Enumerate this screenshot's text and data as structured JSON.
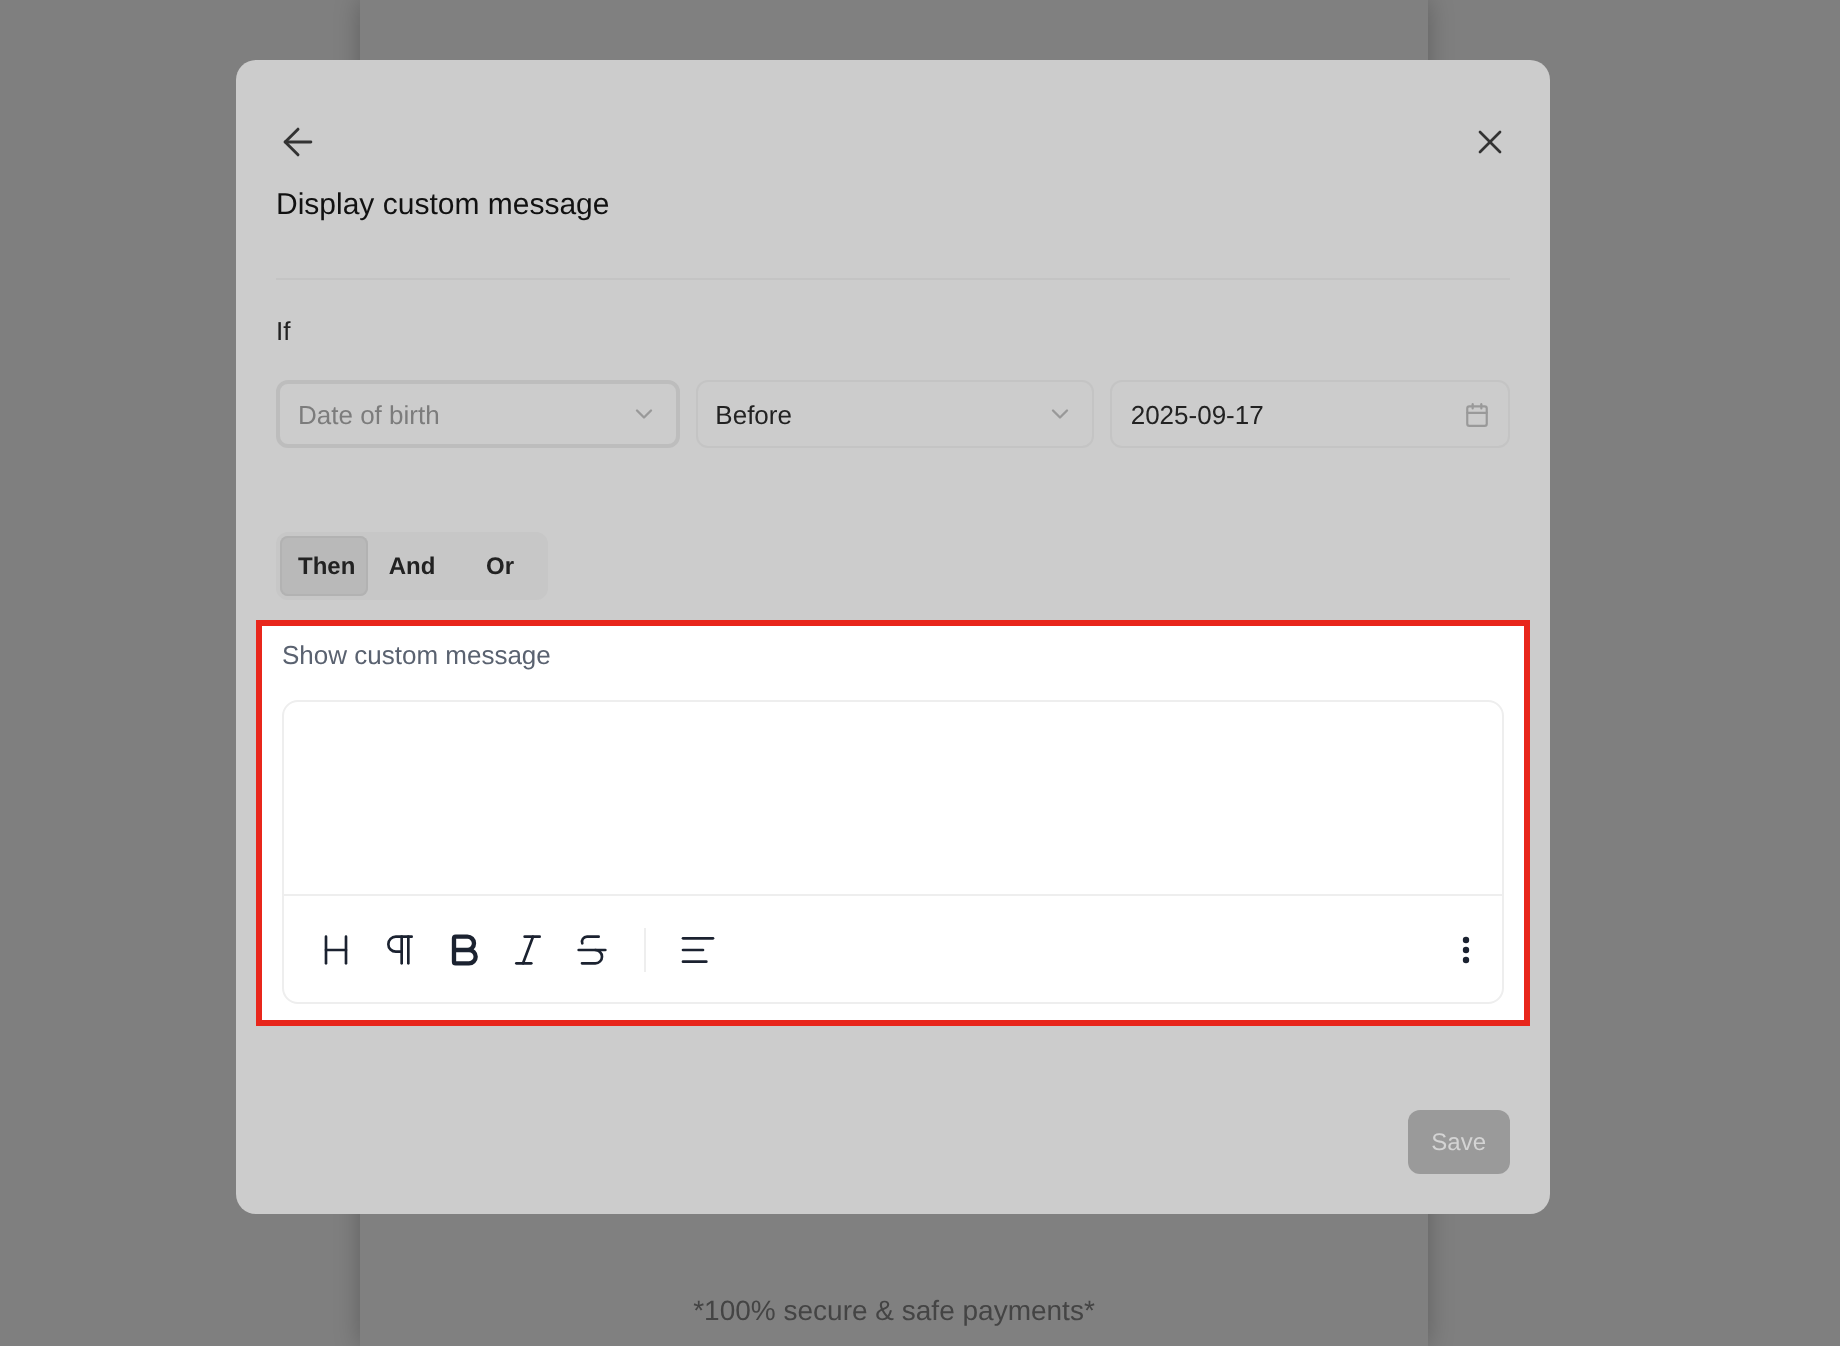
{
  "page": {
    "footer_note": "*100% secure & safe payments*"
  },
  "dialog": {
    "title": "Display custom message",
    "condition": {
      "label": "If",
      "field": {
        "placeholder": "Date of birth",
        "focused": true
      },
      "operator": {
        "value": "Before"
      },
      "date": {
        "value": "2025-09-17"
      }
    },
    "connectors": [
      {
        "label": "Then",
        "selected": true
      },
      {
        "label": "And",
        "selected": false
      },
      {
        "label": "Or",
        "selected": false
      }
    ],
    "action": {
      "label": "Show custom message",
      "highlighted": true,
      "toolbar": [
        {
          "kind": "heading"
        },
        {
          "kind": "paragraph"
        },
        {
          "kind": "bold"
        },
        {
          "kind": "italic"
        },
        {
          "kind": "strike"
        },
        {
          "kind": "divider"
        },
        {
          "kind": "align"
        }
      ]
    },
    "save_button": {
      "label": "Save",
      "disabled": true
    }
  }
}
